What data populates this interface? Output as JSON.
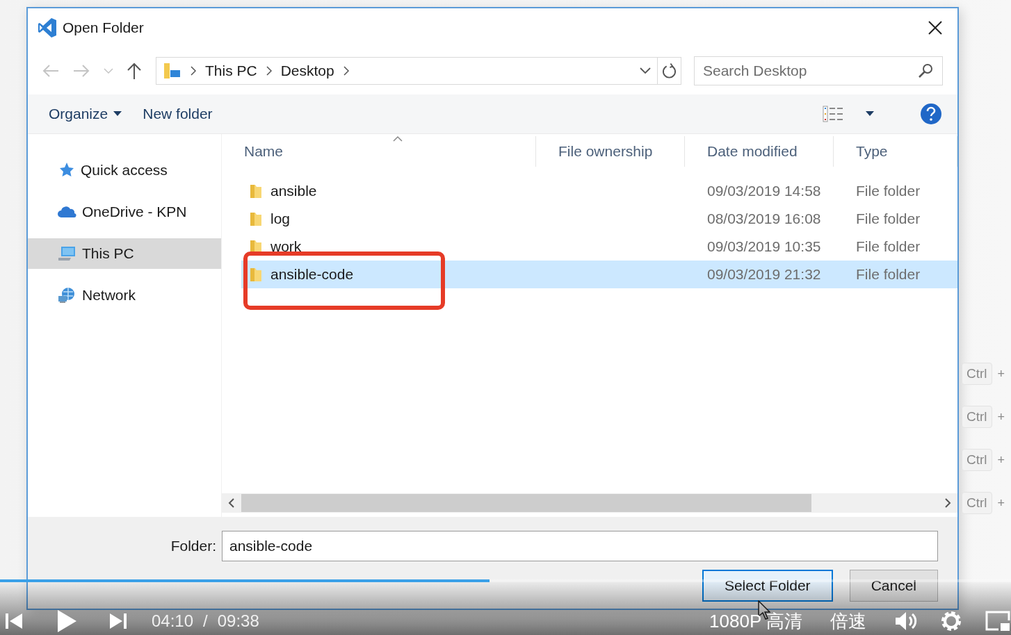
{
  "dialog": {
    "title": "Open Folder",
    "breadcrumb": [
      "This PC",
      "Desktop"
    ],
    "search": {
      "placeholder": "Search Desktop"
    },
    "toolbar": [
      {
        "label": "Organize",
        "kind": "menu"
      },
      {
        "label": "New folder",
        "kind": "button"
      }
    ],
    "nav_pane": [
      {
        "label": "Quick access",
        "kind": "star",
        "selected": false
      },
      {
        "label": "OneDrive - KPN",
        "kind": "cloud",
        "selected": false
      },
      {
        "label": "This PC",
        "kind": "computer",
        "selected": true
      },
      {
        "label": "Network",
        "kind": "network",
        "selected": false
      }
    ],
    "columns": [
      "Name",
      "File ownership",
      "Date modified",
      "Type"
    ],
    "rows": [
      {
        "name": "ansible",
        "date": "09/03/2019 14:58",
        "type": "File folder",
        "selected": false
      },
      {
        "name": "log",
        "date": "08/03/2019 16:08",
        "type": "File folder",
        "selected": false
      },
      {
        "name": "work",
        "date": "09/03/2019 10:35",
        "type": "File folder",
        "selected": false
      },
      {
        "name": "ansible-code",
        "date": "09/03/2019 21:32",
        "type": "File folder",
        "selected": true
      }
    ],
    "folder_field": {
      "label": "Folder:",
      "value": "ansible-code"
    },
    "buttons": [
      {
        "label": "Select Folder",
        "kind": "primary"
      },
      {
        "label": "Cancel",
        "kind": "secondary"
      }
    ]
  },
  "shortcut_hints": [
    {
      "key": "Ctrl",
      "joiner": "+"
    },
    {
      "key": "Ctrl",
      "joiner": "+"
    },
    {
      "key": "Ctrl",
      "joiner": "+"
    },
    {
      "key": "Ctrl",
      "joiner": "+"
    }
  ],
  "player": {
    "level": 0.484,
    "current_time": "04:10",
    "separator": "/",
    "duration": "09:38",
    "quality": "1080P 高清",
    "speed": "倍速"
  }
}
